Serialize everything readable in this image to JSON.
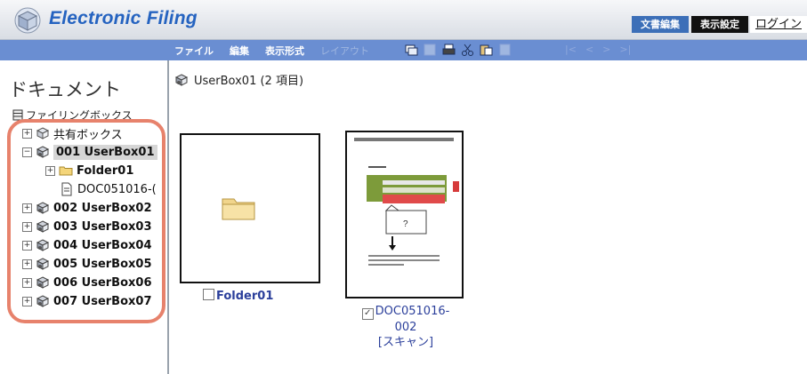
{
  "header": {
    "app_title": "Electronic Filing",
    "edit_button": "文書編集",
    "view_button": "表示設定",
    "login_link": "ログイン",
    "accent_color": "#2563c0"
  },
  "menubar": {
    "items": [
      "ファイル",
      "編集",
      "表示形式",
      "レイアウト"
    ],
    "toolbar_icons": [
      "copy-icon",
      "save-icon",
      "print-icon",
      "cut-icon",
      "paste-icon",
      "clipboard-icon"
    ],
    "nav_icons": [
      "first-page-icon",
      "prev-page-icon",
      "next-page-icon",
      "last-page-icon"
    ],
    "nav_glyphs": [
      "|<",
      "<",
      ">",
      ">|"
    ]
  },
  "left_pane": {
    "title": "ドキュメント",
    "filing_box": "ファイリングボックス",
    "tree": [
      {
        "label": "共有ボックス",
        "expander": "+",
        "icon": "cube-icon"
      },
      {
        "label": "001 UserBox01",
        "expander": "−",
        "icon": "user-box-icon",
        "selected": true
      },
      {
        "label": "Folder01",
        "expander": "+",
        "icon": "folder-icon"
      },
      {
        "label": "DOC051016-(",
        "expander": "",
        "icon": "document-icon"
      },
      {
        "label": "002 UserBox02",
        "expander": "+",
        "icon": "user-box-icon"
      },
      {
        "label": "003 UserBox03",
        "expander": "+",
        "icon": "user-box-icon"
      },
      {
        "label": "004 UserBox04",
        "expander": "+",
        "icon": "user-box-icon"
      },
      {
        "label": "005 UserBox05",
        "expander": "+",
        "icon": "user-box-icon"
      },
      {
        "label": "006 UserBox06",
        "expander": "+",
        "icon": "user-box-icon"
      },
      {
        "label": "007 UserBox07",
        "expander": "+",
        "icon": "user-box-icon"
      }
    ]
  },
  "main": {
    "breadcrumb": "UserBox01 (2 項目)",
    "items": [
      {
        "name": "Folder01",
        "checked": false
      },
      {
        "name_line1": "DOC051016-",
        "name_line2": "002",
        "tag": "[スキャン]",
        "checked": true
      }
    ]
  }
}
